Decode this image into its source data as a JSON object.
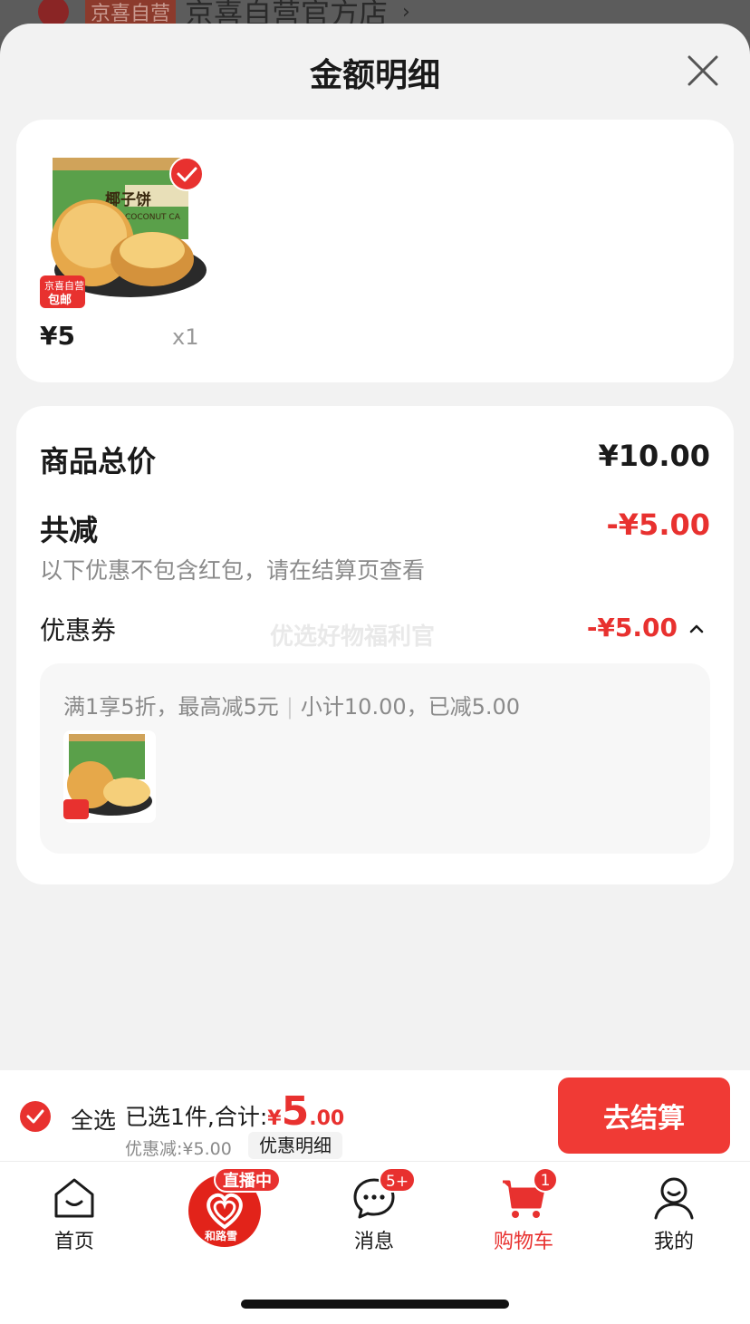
{
  "background_store": {
    "badge": "京喜自营",
    "name": "京喜自营官方店",
    "arrow": "›"
  },
  "sheet": {
    "title": "金额明细"
  },
  "product": {
    "price": "¥5",
    "quantity": "x1",
    "image_label": "椰子饼",
    "image_sublabel": "COCONUT CA",
    "tag_top": "京喜自营",
    "tag_bottom": "包邮"
  },
  "summary": {
    "goods_total_label": "商品总价",
    "goods_total_value": "¥10.00",
    "reduction_label": "共减",
    "reduction_value": "-¥5.00",
    "note": "以下优惠不包含红包，请在结算页查看",
    "coupon_label": "优惠券",
    "coupon_value": "-¥5.00",
    "watermark": "优选好物福利官",
    "coupon_rule": "满1享5折，最高减5元",
    "coupon_subtotal": "小计10.00，已减5.00"
  },
  "checkout": {
    "select_all": "全选",
    "selected_text": "已选1件,合计:",
    "total_symbol": "¥",
    "total_int": "5",
    "total_dec": ".00",
    "discount_text": "优惠减:¥5.00",
    "detail_button": "优惠明细",
    "checkout_button": "去结算"
  },
  "tabbar": {
    "home": "首页",
    "live_badge": "直播中",
    "live_logo_text": "和路雪",
    "messages": "消息",
    "messages_badge": "5+",
    "cart": "购物车",
    "cart_badge": "1",
    "me": "我的"
  },
  "colors": {
    "accent": "#e8312f",
    "checkout_button": "#f03a35"
  }
}
